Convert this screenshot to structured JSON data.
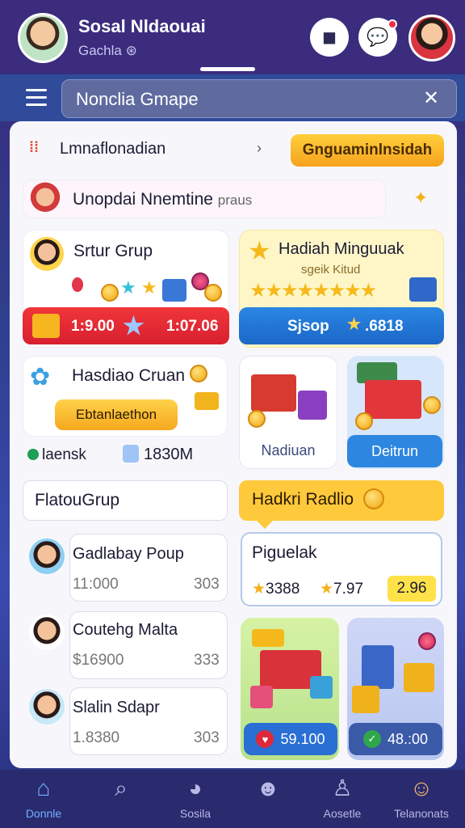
{
  "header": {
    "title": "Sosal Nldaouai",
    "subtitle": "Gachla",
    "camera_icon": "camera-icon",
    "chat_icon": "chat-icon"
  },
  "search": {
    "value": "Nonclia Gmape",
    "close_icon": "close-icon"
  },
  "row1": {
    "label": "Lmnaflonadian",
    "button": "Gnguaminlnsidah"
  },
  "row2": {
    "label": "Unopdai Nnemtine",
    "sub": "praus"
  },
  "cards": {
    "left": {
      "title": "Srtur Grup",
      "value_a": "1:9.00",
      "value_b": "1:07.06"
    },
    "right": {
      "title": "Hadiah Minguuak",
      "subtitle": "sgeik Kitud",
      "value_a": "Sjsop",
      "value_b": ".6818"
    }
  },
  "middle": {
    "title": "Hasdiao Cruan",
    "button": "Ebtanlaethon",
    "stat_a": "laensk",
    "stat_b": "1830M",
    "tile_a": "Nadiuan",
    "tile_b": "Deitrun"
  },
  "section_left": "FlatouGrup",
  "section_right": "Hadkri Radlio",
  "list": [
    {
      "title": "Gadlabay Poup",
      "v1": "11:000",
      "v2": "303"
    },
    {
      "title": "Coutehg Malta",
      "v1": "$16900",
      "v2": "333"
    },
    {
      "title": "Slalin Sdapr",
      "v1": "1.8380",
      "v2": "303"
    }
  ],
  "pig": {
    "title": "Piguelak",
    "v1": "3388",
    "v2": "7.97",
    "v3": "2.96"
  },
  "bottom_tiles": {
    "a_value": "59.100",
    "b_value": "48.:00"
  },
  "nav": [
    {
      "label": "Donnle",
      "icon": "home-icon"
    },
    {
      "label": "",
      "icon": "search-icon"
    },
    {
      "label": "Sosila",
      "icon": "user-badge-icon"
    },
    {
      "label": "",
      "icon": "game-icon"
    },
    {
      "label": "Aosetle",
      "icon": "profile-icon"
    },
    {
      "label": "Telanonats",
      "icon": "avatar-icon"
    }
  ],
  "colors": {
    "accent_yellow": "#ffc93c",
    "accent_blue": "#2d86e0",
    "accent_red": "#e0283a",
    "bg_purple": "#3b2c7e"
  }
}
